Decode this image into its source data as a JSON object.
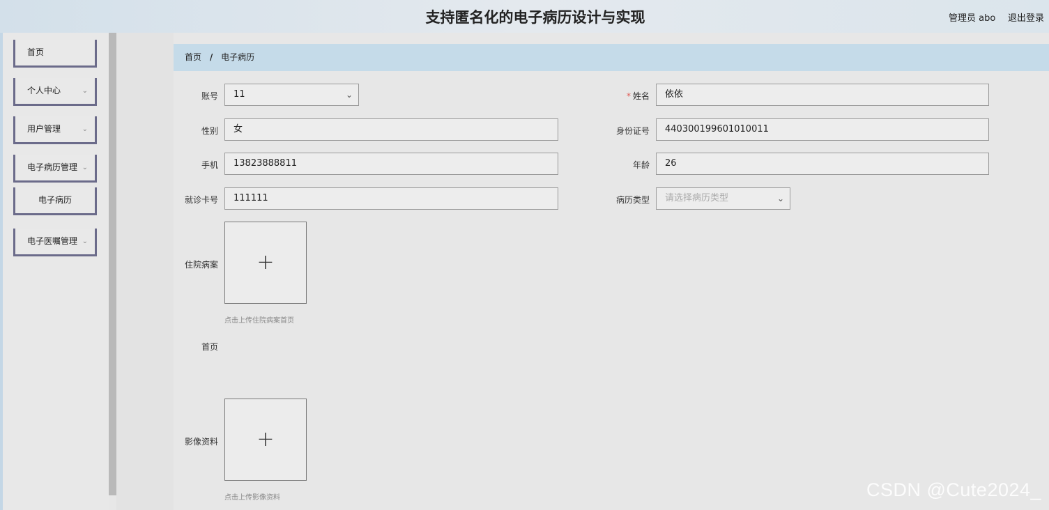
{
  "header": {
    "title": "支持匿名化的电子病历设计与实现",
    "admin_label": "管理员 abo",
    "logout_label": "退出登录"
  },
  "sidebar": {
    "items": [
      {
        "label": "首页"
      },
      {
        "label": "个人中心",
        "icon": "chevron-down-icon"
      },
      {
        "label": "用户管理",
        "icon": "chevron-down-icon"
      },
      {
        "label": "电子病历管理",
        "icon": "chevron-down-icon"
      },
      {
        "label": "电子病历"
      },
      {
        "label": "电子医嘱管理",
        "icon": "chevron-down-icon"
      }
    ]
  },
  "breadcrumb": {
    "home": "首页",
    "separator": "/",
    "current": "电子病历"
  },
  "form": {
    "account": {
      "label": "账号",
      "value": "11"
    },
    "name": {
      "label": "姓名",
      "value": "依依",
      "required": "*"
    },
    "gender": {
      "label": "性别",
      "value": "女"
    },
    "id_number": {
      "label": "身份证号",
      "value": "440300199601010011"
    },
    "phone": {
      "label": "手机",
      "value": "13823888811"
    },
    "age": {
      "label": "年龄",
      "value": "26"
    },
    "card_number": {
      "label": "就诊卡号",
      "value": "111111"
    },
    "record_type": {
      "label": "病历类型",
      "placeholder": "请选择病历类型"
    },
    "inpatient_record": {
      "label": "住院病案",
      "hint": "点击上传住院病案首页"
    },
    "home_page": {
      "label": "首页"
    },
    "imaging": {
      "label": "影像资料",
      "hint": "点击上传影像资料"
    }
  },
  "watermark": "CSDN @Cute2024_"
}
